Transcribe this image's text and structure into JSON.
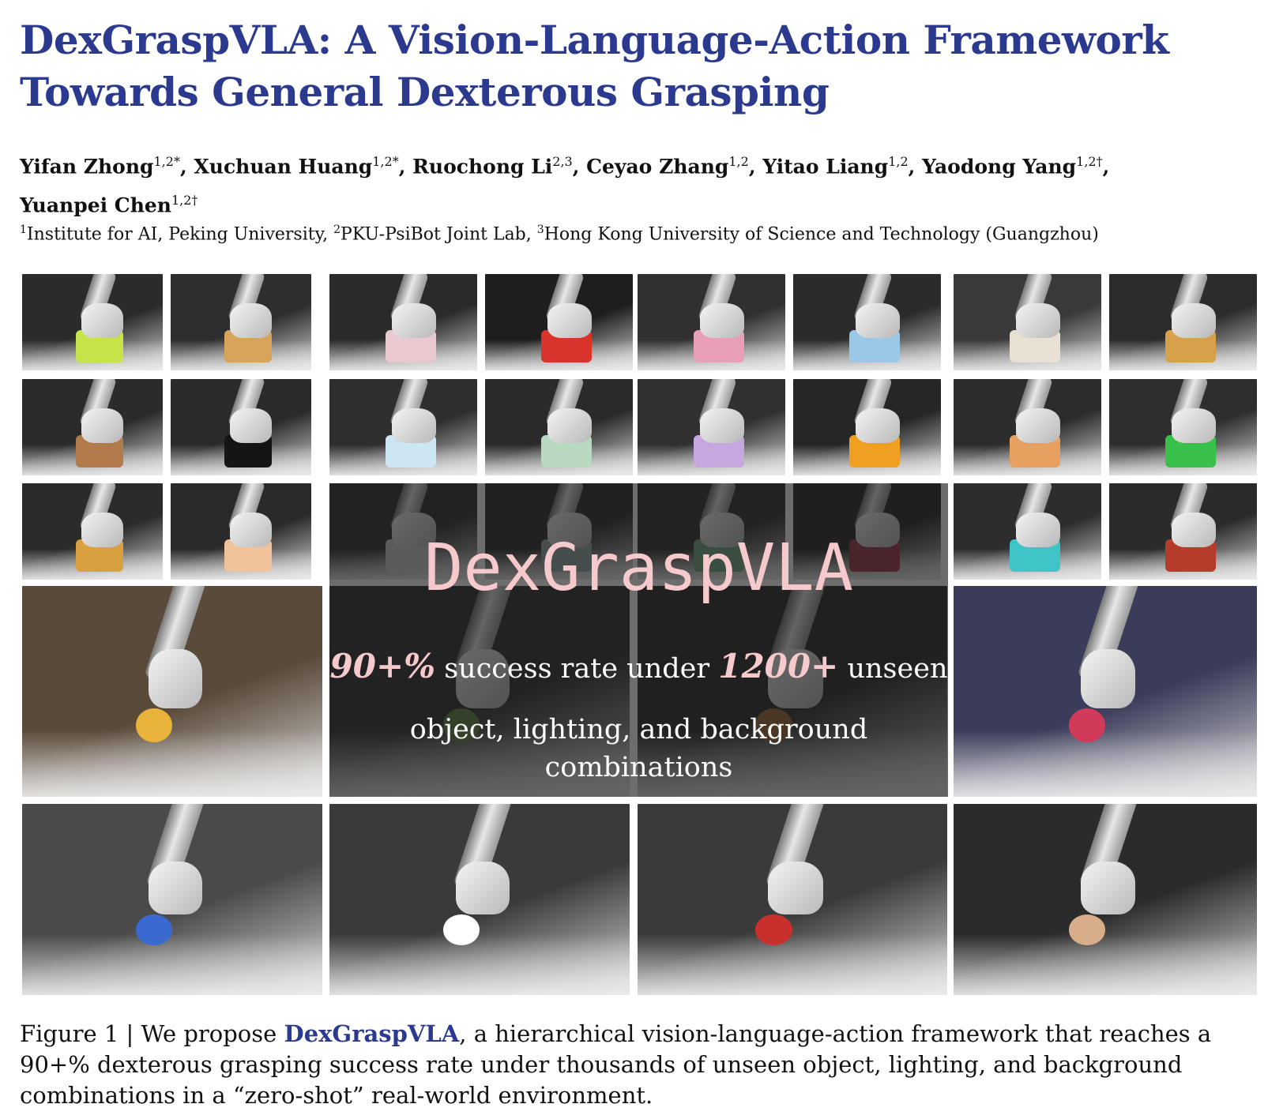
{
  "paper": {
    "title": "DexGraspVLA: A Vision-Language-Action Framework Towards General Dexterous Grasping",
    "authors": [
      {
        "name": "Yifan Zhong",
        "affil": "1,2*"
      },
      {
        "name": "Xuchuan Huang",
        "affil": "1,2*"
      },
      {
        "name": "Ruochong Li",
        "affil": "2,3"
      },
      {
        "name": "Ceyao Zhang",
        "affil": "1,2"
      },
      {
        "name": "Yitao Liang",
        "affil": "1,2"
      },
      {
        "name": "Yaodong Yang",
        "affil": "1,2†"
      },
      {
        "name": "Yuanpei Chen",
        "affil": "1,2†"
      }
    ],
    "affiliations": [
      {
        "num": "1",
        "name": "Institute for AI, Peking University"
      },
      {
        "num": "2",
        "name": "PKU-PsiBot Joint Lab"
      },
      {
        "num": "3",
        "name": "Hong Kong University of Science and Technology (Guangzhou)"
      }
    ]
  },
  "figure": {
    "overlay": {
      "brand": "DexGraspVLA",
      "hl1": "90+%",
      "text1": "success rate under",
      "hl2": "1200+",
      "text2": "unseen",
      "line2": "object, lighting, and background combinations"
    },
    "caption": {
      "prefix": "Figure 1 | We propose ",
      "highlight": "DexGraspVLA",
      "rest": ", a hierarchical vision-language-action framework that reaches a 90+% dexterous grasping success rate under thousands of unseen object, lighting, and background combinations in a “zero-shot” real-world environment."
    },
    "colors": {
      "title": "#2b3a8f",
      "overlay_accent": "#f6c9cc"
    }
  }
}
